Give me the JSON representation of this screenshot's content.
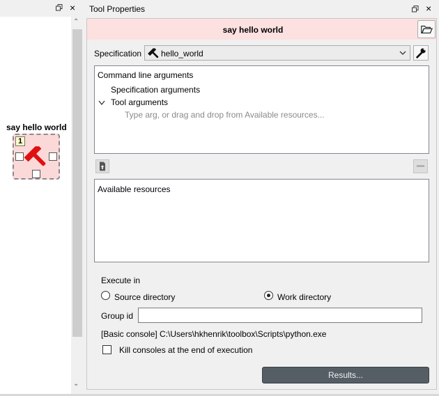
{
  "left_dock": {
    "close_glyph": "×",
    "item": {
      "name": "say hello world",
      "execution_count": "1",
      "icon": "hammer-icon"
    },
    "scroll_up_glyph": "⌃",
    "scroll_down_glyph": "⌄"
  },
  "tool_properties": {
    "title": "Tool Properties",
    "close_glyph": "×",
    "item_name": "say hello world",
    "specification_label": "Specification",
    "specification_value": "hello_world",
    "arguments_tree": {
      "root": "Command line arguments",
      "spec_args": "Specification arguments",
      "tool_args": "Tool arguments",
      "hint": "Type arg, or drag and drop from Available resources..."
    },
    "available_resources_label": "Available resources",
    "execute_in_label": "Execute in",
    "source_dir_label": "Source directory",
    "work_dir_label": "Work directory",
    "selected_execute_in": "work",
    "group_id_label": "Group id",
    "group_id_value": "",
    "console_info": "[Basic console] C:\\Users\\hkhenrik\\toolbox\\Scripts\\python.exe",
    "kill_consoles_label": "Kill consoles at the end of execution",
    "kill_consoles_checked": false,
    "results_label": "Results..."
  },
  "colors": {
    "item_bg": "#fde0e0",
    "hammer": "#e01010",
    "results_button": "#555e65"
  }
}
